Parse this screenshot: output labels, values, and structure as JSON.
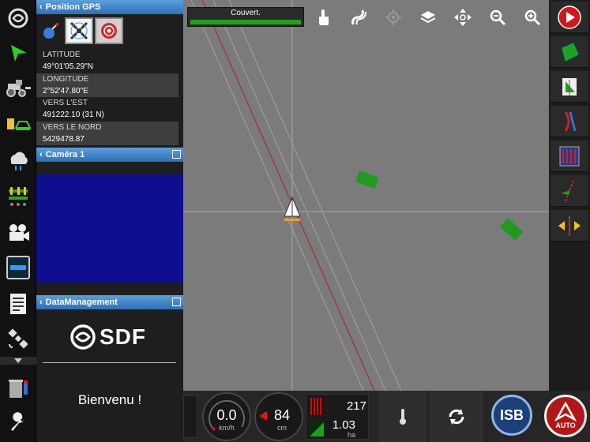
{
  "gps_panel": {
    "title": "Position GPS",
    "rows": [
      {
        "label": "LATITUDE",
        "value": "49°01'05.29\"N"
      },
      {
        "label": "LONGITUDE",
        "value": "2°52'47.80\"E"
      },
      {
        "label": "VERS L'EST",
        "value": "491222.10 (31 N)"
      },
      {
        "label": "VERS LE NORD",
        "value": "5429478.87"
      }
    ]
  },
  "camera_panel": {
    "title": "Caméra 1",
    "feed_color": "#0d0f8f"
  },
  "data_panel": {
    "title": "DataManagement",
    "logo_text": "SDF",
    "welcome": "Bienvenu !"
  },
  "coverage": {
    "label": "Couvert.",
    "fraction": 1.0
  },
  "status": {
    "speed": "0.0",
    "speed_unit": "km/h",
    "offset": "84",
    "offset_unit": "cm",
    "count": "217",
    "area": "1.03",
    "area_unit": "ha",
    "isb_label": "ISB",
    "auto_label": "AUTO"
  },
  "colors": {
    "map": "#7b7b7b",
    "accent": "#2f6fb2",
    "record": "#d01818",
    "green": "#1fa01f"
  }
}
